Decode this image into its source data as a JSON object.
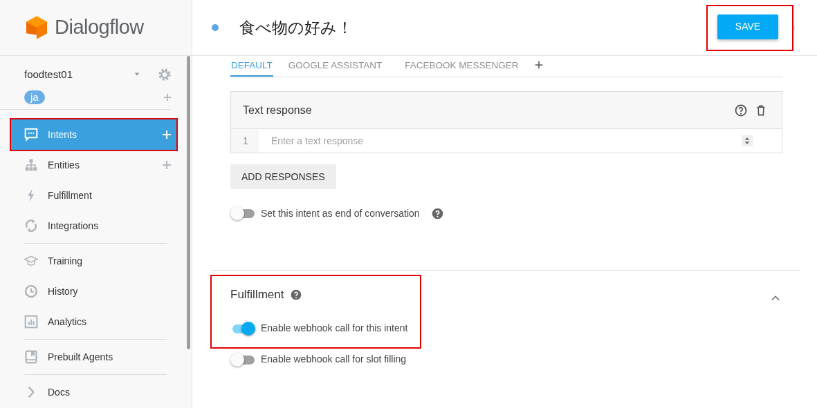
{
  "sidebar": {
    "logo": "Dialogflow",
    "agent": "foodtest01",
    "language": "ja",
    "groups": [
      [
        {
          "label": "Intents",
          "selected": true,
          "add": true,
          "highlighted": true
        },
        {
          "label": "Entities",
          "selected": false,
          "add": true,
          "highlighted": false
        },
        {
          "label": "Fulfillment",
          "selected": false,
          "add": false,
          "highlighted": false
        },
        {
          "label": "Integrations",
          "selected": false,
          "add": false,
          "highlighted": false
        }
      ],
      [
        {
          "label": "Training",
          "selected": false,
          "add": false,
          "highlighted": false
        },
        {
          "label": "History",
          "selected": false,
          "add": false,
          "highlighted": false
        },
        {
          "label": "Analytics",
          "selected": false,
          "add": false,
          "highlighted": false
        }
      ],
      [
        {
          "label": "Prebuilt Agents",
          "selected": false,
          "add": false,
          "highlighted": false
        }
      ],
      [
        {
          "label": "Docs",
          "selected": false,
          "add": false,
          "highlighted": false
        }
      ]
    ]
  },
  "header": {
    "title": "食べ物の好み！",
    "save": "SAVE",
    "save_highlighted": true
  },
  "tabs": [
    {
      "label": "DEFAULT",
      "selected": true
    },
    {
      "label": "GOOGLE ASSISTANT",
      "selected": false
    },
    {
      "label": "FACEBOOK MESSENGER",
      "selected": false
    }
  ],
  "text_response": {
    "title": "Text response",
    "rows": [
      {
        "number": "1",
        "placeholder": "Enter a text response"
      }
    ]
  },
  "add_responses": "ADD RESPONSES",
  "end_conversation": {
    "label": "Set this intent as end of conversation",
    "on": false
  },
  "fulfillment": {
    "title": "Fulfillment",
    "expanded": true,
    "highlighted": true,
    "toggles": [
      {
        "label": "Enable webhook call for this intent",
        "on": true
      },
      {
        "label": "Enable webhook call for slot filling",
        "on": false
      }
    ]
  }
}
